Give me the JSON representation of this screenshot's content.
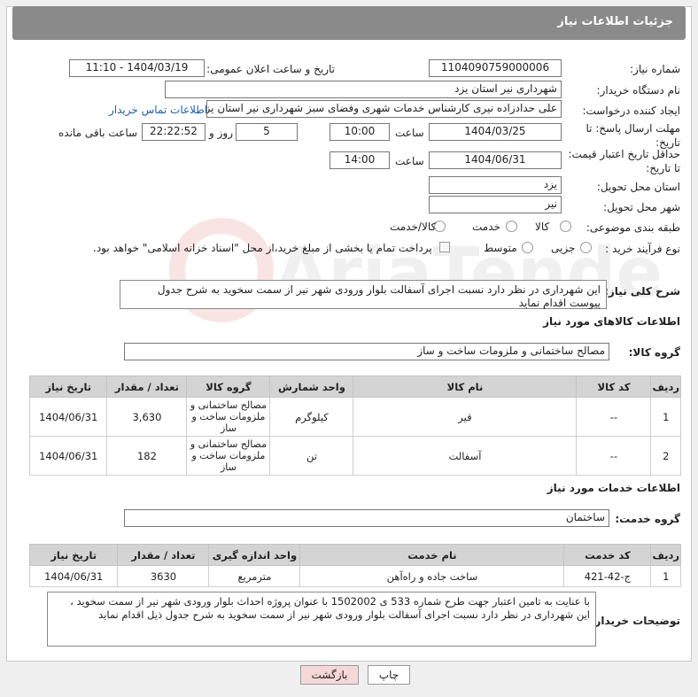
{
  "page": {
    "title": "جزئیات اطلاعات نیاز"
  },
  "labels": {
    "need_number": "شماره نیاز:",
    "announce_datetime": "تاریخ و ساعت اعلان عمومی:",
    "buyer_org": "نام دستگاه خریدار:",
    "requester": "ایجاد کننده درخواست:",
    "send_deadline": "مهلت ارسال پاسخ: تا تاریخ:",
    "min_price_validity": "حداقل تاریخ اعتبار قیمت: تا تاریخ:",
    "time": "ساعت",
    "day_and": "روز و",
    "remaining": "ساعت باقی مانده",
    "delivery_province": "استان محل تحویل:",
    "delivery_city": "شهر محل تحویل:",
    "subject_class": "طبقه بندی موضوعی:",
    "purchase_type": "نوع فرآیند خرید :",
    "general_desc": "شرح کلی نیاز:",
    "goods_info": "اطلاعات کالاهای مورد نیاز",
    "goods_group": "گروه کالا:",
    "services_info": "اطلاعات خدمات مورد نیاز",
    "service_group": "گروه خدمت:",
    "buyer_notes": "توضیحات خریدار:"
  },
  "values": {
    "need_number": "1104090759000006",
    "announce_datetime": "1404/03/19 - 11:10",
    "buyer_org": "شهرداری نیر استان یزد",
    "requester": "علی حدادزاده نیری کارشناس خدمات شهری وفضای سبز شهرداری نیر استان یزد",
    "contact_link": "اطلاعات تماس خریدار",
    "send_date": "1404/03/25",
    "send_time": "10:00",
    "days": "5",
    "remaining_time": "22:22:52",
    "validity_date": "1404/06/31",
    "validity_time": "14:00",
    "province": "یزد",
    "city": "نیر",
    "general_desc": "این شهرداری در نظر دارد نسبت اجرای آسفالت بلوار ورودی شهر نیر از سمت سخوید  به شرح جدول پیوست اقدام نماید",
    "goods_group": "مصالح ساختمانی و ملزومات ساخت و ساز",
    "service_group": "ساختمان",
    "buyer_notes_1": "با عنایت به تامین اعتبار جهت طرح شماره 533 ی 1502002 با عنوان پروژه احداث بلوار ورودی شهر نیر از سمت سخوید  ،",
    "buyer_notes_2": "این شهرداری در نظر دارد نسبت اجرای آسفالت بلوار ورودی شهر نیر از سمت سخوید  به شرح جدول ذیل  اقدام نماید"
  },
  "subject_options": [
    "کالا",
    "خدمت",
    "کالا/خدمت"
  ],
  "purchase_options": [
    "جزیی",
    "متوسط"
  ],
  "payment_note": "پرداخت تمام یا بخشی از مبلغ خرید،از محل \"اسناد خزانه اسلامی\" خواهد بود.",
  "goods_table": {
    "headers": [
      "ردیف",
      "کد کالا",
      "نام کالا",
      "واحد شمارش",
      "گروه کالا",
      "تعداد / مقدار",
      "تاریخ نیاز"
    ],
    "rows": [
      [
        "1",
        "--",
        "قیر",
        "کیلوگرم",
        "مصالح ساختمانی و ملزومات ساخت و ساز",
        "3,630",
        "1404/06/31"
      ],
      [
        "2",
        "--",
        "آسفالت",
        "تن",
        "مصالح ساختمانی و ملزومات ساخت و ساز",
        "182",
        "1404/06/31"
      ]
    ]
  },
  "services_table": {
    "headers": [
      "ردیف",
      "کد خدمت",
      "نام خدمت",
      "واحد اندازه گیری",
      "تعداد / مقدار",
      "تاریخ نیاز"
    ],
    "rows": [
      [
        "1",
        "ج-42-421",
        "ساخت جاده و راه‌آهن",
        "مترمربع",
        "3630",
        "1404/06/31"
      ]
    ]
  },
  "buttons": {
    "print": "چاپ",
    "back": "بازگشت"
  }
}
